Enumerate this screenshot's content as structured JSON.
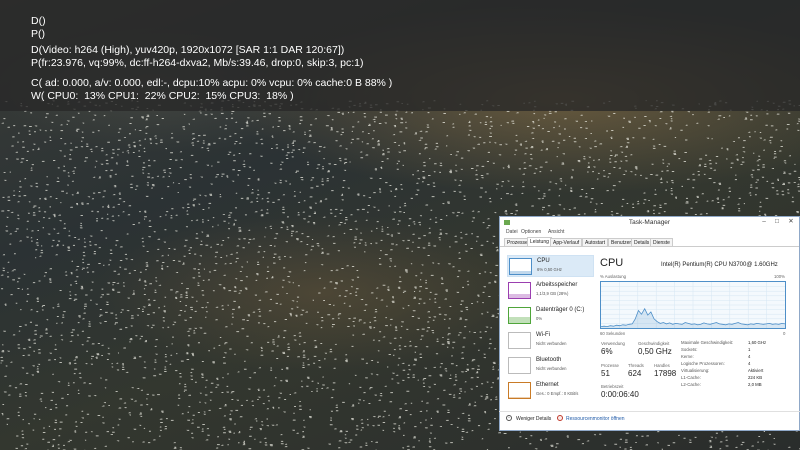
{
  "osd": {
    "lines": [
      "D()",
      "P()",
      "D(Video: h264 (High), yuv420p, 1920x1072 [SAR 1:1 DAR 120:67])",
      "P(fr:23.976, vq:99%, dc:ff-h264-dxva2, Mb/s:39.46, drop:0, skip:3, pc:1)",
      "C( ad: 0.000, a/v: 0.000, edl:-, dcpu:10% acpu: 0% vcpu: 0% cache:0 B 88% )",
      "W( CPU0:  13% CPU1:  22% CPU2:  15% CPU3:  18% )"
    ]
  },
  "taskmanager": {
    "title": "Task-Manager",
    "window_buttons": [
      "–",
      "□",
      "✕"
    ],
    "menu": [
      "Datei",
      "Optionen",
      "Ansicht"
    ],
    "tabs": [
      "Prozesse",
      "Leistung",
      "App-Verlauf",
      "Autostart",
      "Benutzer",
      "Details",
      "Dienste"
    ],
    "active_tab": "Leistung",
    "resources": [
      {
        "name": "CPU",
        "sub": "6% 0,50 GHz",
        "color": "#4e8fc8"
      },
      {
        "name": "Arbeitsspeicher",
        "sub": "1,1/3,9 GB (28%)",
        "color": "#9b3fb0"
      },
      {
        "name": "Datenträger 0 (C:)",
        "sub": "0%",
        "color": "#4fa53a"
      },
      {
        "name": "Wi-Fi",
        "sub": "Nicht verbunden",
        "color": "#bbbbbb"
      },
      {
        "name": "Bluetooth",
        "sub": "Nicht verbunden",
        "color": "#bbbbbb"
      },
      {
        "name": "Ethernet",
        "sub": "Ges.: 0 Empf.: 0 KBit/s",
        "color": "#c97b27"
      }
    ],
    "panel": {
      "title": "CPU",
      "model": "Intel(R) Pentium(R) CPU N3700@ 1.60GHz",
      "graph_label_left": "% Auslastung",
      "graph_label_right": "100%",
      "graph_bottom_left": "60 Sekunden",
      "graph_bottom_right": "0",
      "utilization_series": [
        3,
        4,
        3,
        5,
        4,
        6,
        5,
        7,
        6,
        8,
        9,
        20,
        38,
        30,
        42,
        28,
        35,
        20,
        14,
        10,
        12,
        9,
        11,
        8,
        10,
        9,
        8,
        12,
        10,
        8,
        9,
        7,
        8,
        11,
        9,
        8,
        10,
        12,
        9,
        8,
        7,
        9,
        8,
        10,
        12,
        9,
        8,
        7,
        9,
        8,
        10,
        9,
        8,
        9,
        10,
        8,
        9,
        8,
        10,
        9
      ],
      "stats": [
        {
          "label": "Verwendung",
          "value": "6%"
        },
        {
          "label": "Geschwindigkeit",
          "value": "0,50 GHz"
        },
        {
          "label": "Prozesse",
          "value": "51"
        },
        {
          "label": "Threads",
          "value": "624"
        },
        {
          "label": "Handles",
          "value": "17898"
        },
        {
          "label": "Betriebszeit",
          "value": "0:00:06:40"
        }
      ],
      "specs": [
        {
          "label": "Maximale Geschwindigkeit:",
          "value": "1,60 GHz"
        },
        {
          "label": "Sockets:",
          "value": "1"
        },
        {
          "label": "Kerne:",
          "value": "4"
        },
        {
          "label": "Logische Prozessoren:",
          "value": "4"
        },
        {
          "label": "Virtualisierung:",
          "value": "Aktiviert"
        },
        {
          "label": "L1-Cache:",
          "value": "224 KB"
        },
        {
          "label": "L2-Cache:",
          "value": "2,0 MB"
        }
      ]
    },
    "footer": {
      "less_details": "Weniger Details",
      "resource_monitor": "Ressourcenmonitor öffnen"
    }
  }
}
